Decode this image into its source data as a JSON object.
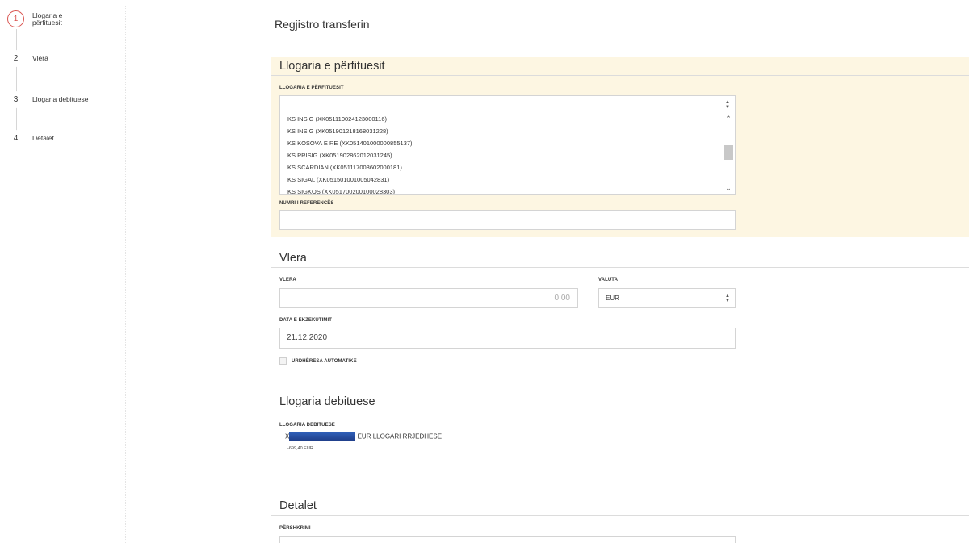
{
  "steps": [
    {
      "num": "1",
      "label": "Llogaria e përfituesit"
    },
    {
      "num": "2",
      "label": "Vlera"
    },
    {
      "num": "3",
      "label": "Llogaria debituese"
    },
    {
      "num": "4",
      "label": "Detalet"
    }
  ],
  "page_title": "Regjistro transferin",
  "beneficiary": {
    "heading": "Llogaria e përfituesit",
    "account_label": "LLOGARIA E PËRFITUESIT",
    "account_value": "",
    "dropdown_items": [
      "KS INSIG (XK051110024123000116)",
      "KS INSIG (XK051901218168031228)",
      "KS KOSOVA E RE (XK051401000000855137)",
      "KS PRISIG (XK051902862012031245)",
      "KS SCARDIAN (XK051117008602000181)",
      "KS SIGAL (XK051501001005042831)",
      "KS SIGKOS (XK051700200100028303)"
    ],
    "reference_label": "NUMRI I REFERENCËS",
    "reference_value": ""
  },
  "amount": {
    "heading": "Vlera",
    "amount_label": "VLERA",
    "amount_placeholder": "0,00",
    "currency_label": "VALUTA",
    "currency_value": "EUR",
    "date_label": "DATA E EKZEKUTIMIT",
    "date_value": "21.12.2020",
    "auto_label": "URDHËRESA AUTOMATIKE"
  },
  "debit": {
    "heading": "Llogaria debituese",
    "label": "LLOGARIA DEBITUESE",
    "account_prefix": "X",
    "account_suffix": "EUR LLOGARI RRJEDHESE",
    "balance": "-699,40 EUR"
  },
  "details": {
    "heading": "Detalet",
    "description_label": "PËRSHKRIMI"
  },
  "colors": {
    "active_step": "#d9534f",
    "section_bg": "#fdf6e2"
  }
}
